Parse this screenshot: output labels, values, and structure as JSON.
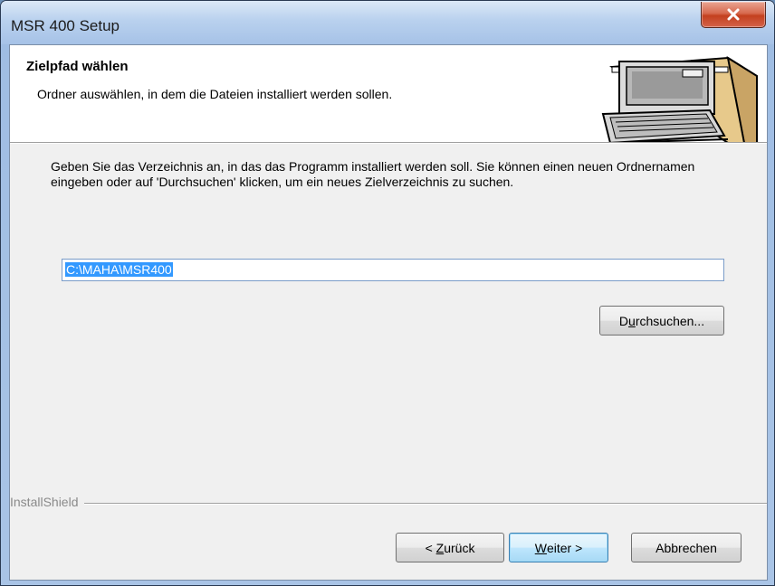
{
  "window": {
    "title": "MSR 400 Setup",
    "close_icon": "close-icon"
  },
  "header": {
    "title": "Zielpfad wählen",
    "subtitle": "Ordner auswählen, in dem die Dateien installiert werden sollen.",
    "image_icon": "computer-illustration"
  },
  "body": {
    "description": "Geben Sie das Verzeichnis an, in das das Programm installiert werden soll. Sie können einen neuen Ordnernamen eingeben oder auf 'Durchsuchen' klicken, um ein neues Zielverzeichnis zu suchen.",
    "path_value": "C:\\MAHA\\MSR400",
    "browse_label_pre": "D",
    "browse_label_ul": "u",
    "browse_label_post": "rchsuchen..."
  },
  "footer": {
    "brand": "InstallShield",
    "back_pre": "< ",
    "back_ul": "Z",
    "back_post": "urück",
    "next_ul": "W",
    "next_post": "eiter >",
    "cancel_label": "Abbrechen"
  },
  "colors": {
    "selection": "#3399ff",
    "close_button": "#c3401f",
    "default_button_border": "#3c7fb1"
  }
}
